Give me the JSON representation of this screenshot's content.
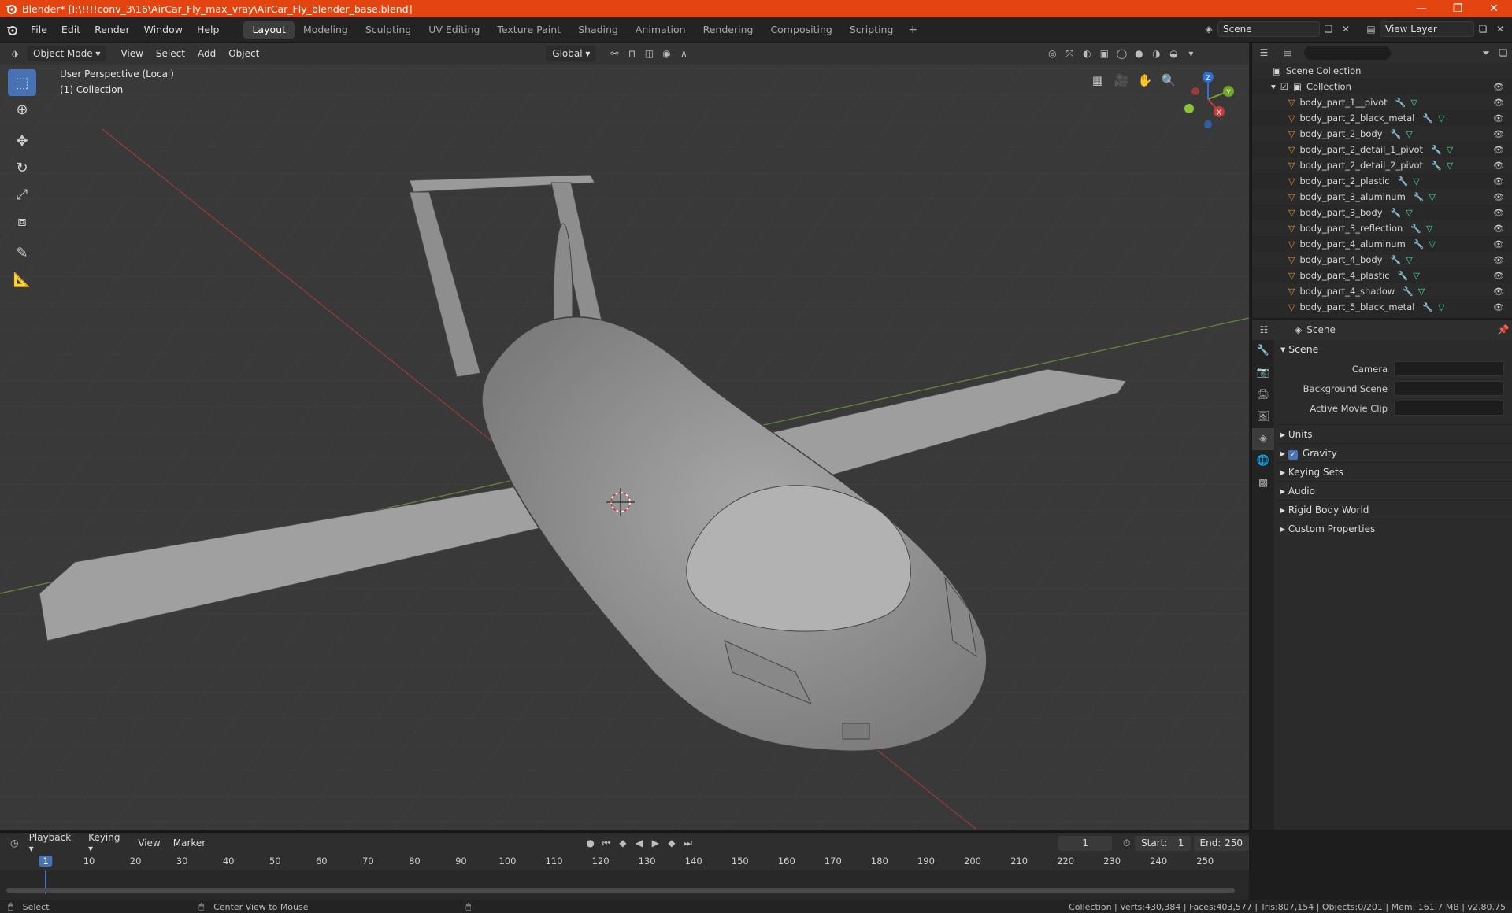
{
  "window": {
    "title": "Blender* [I:\\!!!!conv_3\\16\\AirCar_Fly_max_vray\\AirCar_Fly_blender_base.blend]",
    "minimize": "—",
    "maximize": "❐",
    "close": "✕"
  },
  "menu": [
    "File",
    "Edit",
    "Render",
    "Window",
    "Help"
  ],
  "workspaces": [
    "Layout",
    "Modeling",
    "Sculpting",
    "UV Editing",
    "Texture Paint",
    "Shading",
    "Animation",
    "Rendering",
    "Compositing",
    "Scripting"
  ],
  "active_workspace": "Layout",
  "scene_name": "Scene",
  "view_layer": "View Layer",
  "viewport": {
    "mode": "Object Mode",
    "menus": [
      "View",
      "Select",
      "Add",
      "Object"
    ],
    "transform_orientation": "Global",
    "info_line1": "User Perspective (Local)",
    "info_line2": "(1) Collection",
    "gizmo": {
      "x": "X",
      "y": "Y",
      "z": "Z"
    }
  },
  "outliner": {
    "scene_collection": "Scene Collection",
    "collection": "Collection",
    "items": [
      "body_part_1__pivot",
      "body_part_2_black_metal",
      "body_part_2_body",
      "body_part_2_detail_1_pivot",
      "body_part_2_detail_2_pivot",
      "body_part_2_plastic",
      "body_part_3_aluminum",
      "body_part_3_body",
      "body_part_3_reflection",
      "body_part_4_aluminum",
      "body_part_4_body",
      "body_part_4_plastic",
      "body_part_4_shadow",
      "body_part_5_black_metal"
    ]
  },
  "properties": {
    "context": "Scene",
    "panel": "Scene",
    "camera_label": "Camera",
    "background_scene_label": "Background Scene",
    "active_movie_clip_label": "Active Movie Clip",
    "subpanels": [
      "Units",
      "Gravity",
      "Keying Sets",
      "Audio",
      "Rigid Body World",
      "Custom Properties"
    ]
  },
  "timeline": {
    "menus": [
      "Playback",
      "Keying",
      "View",
      "Marker"
    ],
    "current_frame": "1",
    "start_label": "Start:",
    "start": "1",
    "end_label": "End:",
    "end": "250",
    "ruler": [
      "10",
      "20",
      "30",
      "40",
      "50",
      "60",
      "70",
      "80",
      "90",
      "100",
      "110",
      "120",
      "130",
      "140",
      "150",
      "160",
      "170",
      "180",
      "190",
      "200",
      "210",
      "220",
      "230",
      "240",
      "250"
    ]
  },
  "statusbar": {
    "select": "Select",
    "center": "Center View to Mouse",
    "stats": "Collection | Verts:430,384 | Faces:403,577 | Tris:807,154 | Objects:0/201 | Mem: 161.7 MB | v2.80.75"
  }
}
